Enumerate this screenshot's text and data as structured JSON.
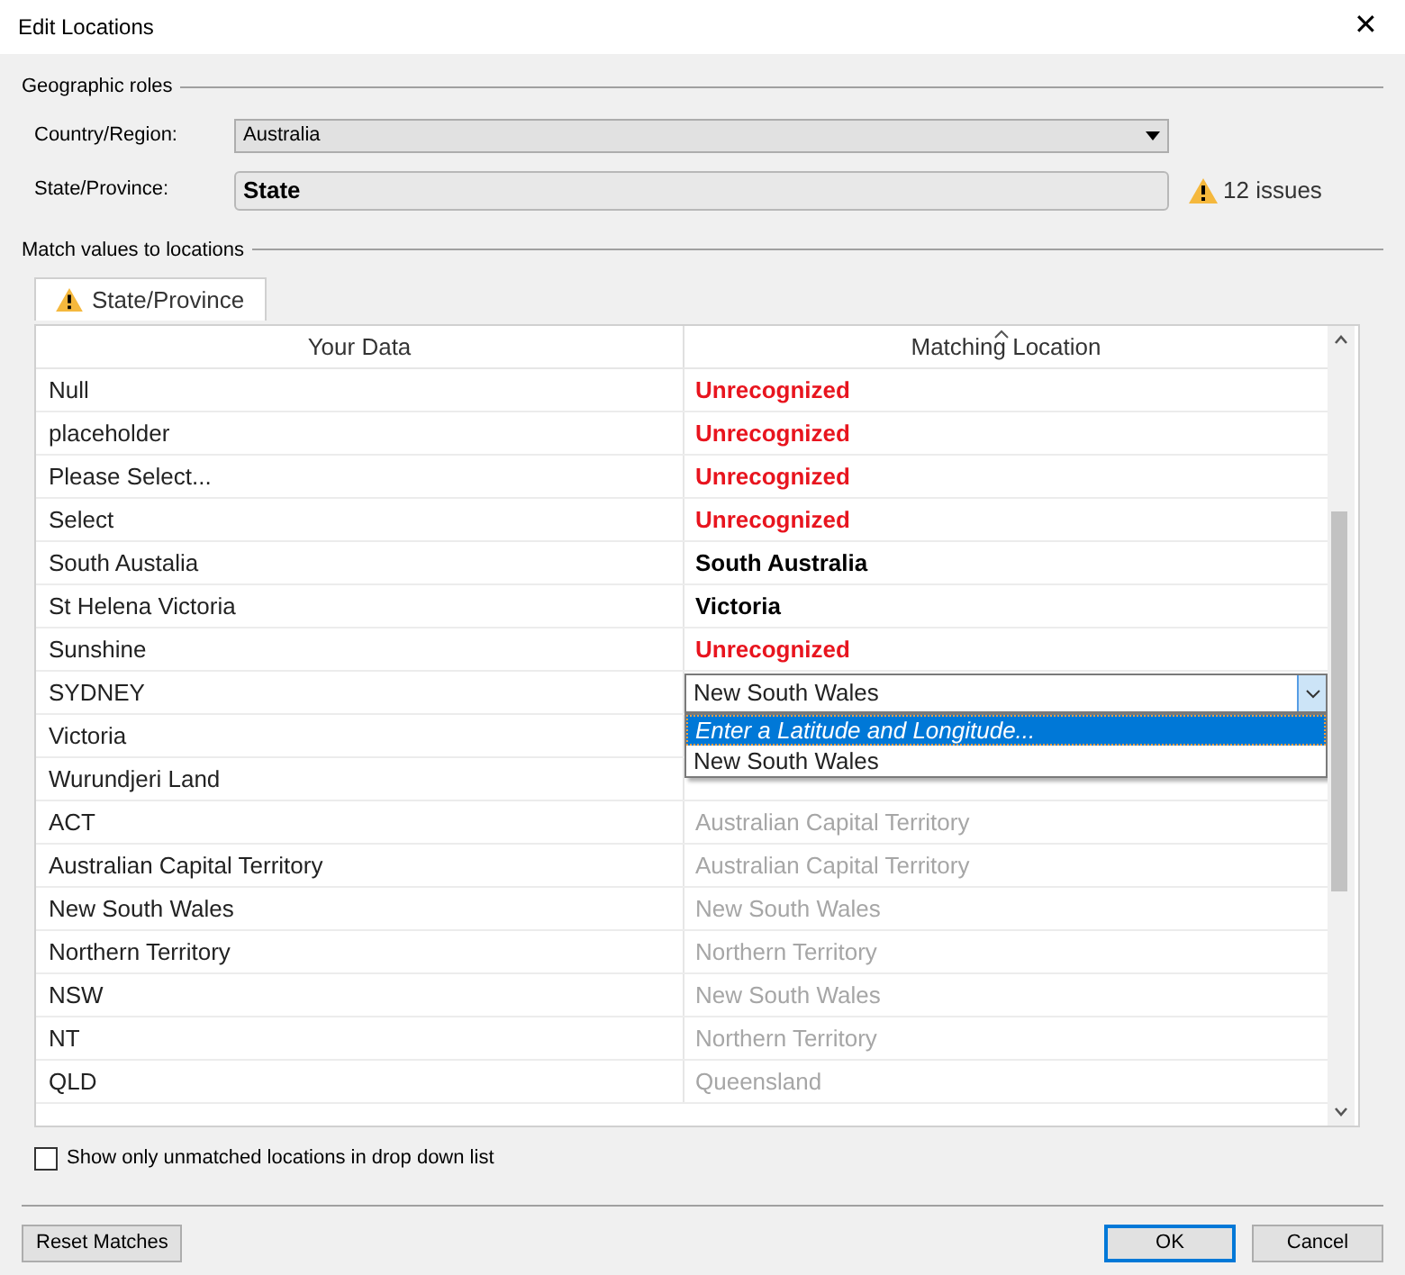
{
  "window": {
    "title": "Edit Locations",
    "close": "✕"
  },
  "geographic_roles": {
    "heading": "Geographic roles",
    "country_label": "Country/Region:",
    "country_value": "Australia",
    "state_label": "State/Province:",
    "state_value": "State",
    "issues": "12 issues"
  },
  "match": {
    "heading": "Match values to locations",
    "tab": {
      "label": "State/Province",
      "selected": true
    },
    "columns": [
      "Your Data",
      "Matching Location"
    ],
    "rows": [
      {
        "data": "Null",
        "kind": "unrecognized",
        "location": "Unrecognized"
      },
      {
        "data": "placeholder",
        "kind": "unrecognized",
        "location": "Unrecognized"
      },
      {
        "data": "Please Select...",
        "kind": "unrecognized",
        "location": "Unrecognized"
      },
      {
        "data": "Select",
        "kind": "unrecognized",
        "location": "Unrecognized"
      },
      {
        "data": "South Austalia",
        "kind": "matched",
        "location": "South Australia"
      },
      {
        "data": "St Helena Victoria",
        "kind": "matched",
        "location": "Victoria"
      },
      {
        "data": "Sunshine",
        "kind": "unrecognized",
        "location": "Unrecognized"
      },
      {
        "data": "SYDNEY",
        "kind": "editing",
        "location": "New South Wales",
        "options": [
          {
            "label": "Enter a Latitude and Longitude...",
            "selected": true
          },
          {
            "label": "New South Wales",
            "selected": false
          }
        ]
      },
      {
        "data": "Victoria",
        "kind": "covered"
      },
      {
        "data": "Wurundjeri Land",
        "kind": "covered"
      },
      {
        "data": "ACT",
        "kind": "auto",
        "location": "Australian Capital Territory"
      },
      {
        "data": "Australian Capital Territory",
        "kind": "auto",
        "location": "Australian Capital Territory"
      },
      {
        "data": "New South Wales",
        "kind": "auto",
        "location": "New South Wales"
      },
      {
        "data": "Northern Territory",
        "kind": "auto",
        "location": "Northern Territory"
      },
      {
        "data": "NSW",
        "kind": "auto",
        "location": "New South Wales"
      },
      {
        "data": "NT",
        "kind": "auto",
        "location": "Northern Territory"
      },
      {
        "data": "QLD",
        "kind": "auto",
        "location": "Queensland"
      }
    ]
  },
  "show_unmatched": {
    "label": "Show only unmatched locations in drop down list",
    "checked": false
  },
  "buttons": {
    "reset": "Reset Matches",
    "ok": "OK",
    "cancel": "Cancel"
  }
}
